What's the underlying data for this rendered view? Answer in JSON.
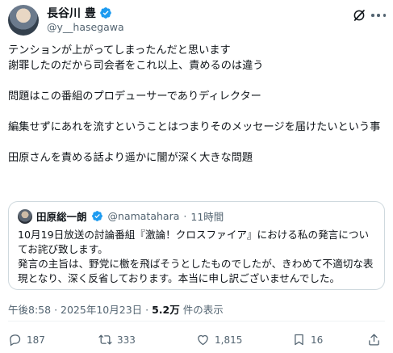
{
  "author": {
    "name": "長谷川 豊",
    "handle": "@y__hasegawa"
  },
  "post": {
    "lines": [
      "テンションが上がってしまったんだと思います",
      "謝罪したのだから司会者をこれ以上、責めるのは違う",
      "",
      "問題はこの番組のプロデューサーでありディレクター",
      "",
      "編集せずにあれを流すということはつまりそのメッセージを届けたいという事",
      "",
      "田原さんを責める話より遥かに闇が深く大きな問題"
    ]
  },
  "quote": {
    "name": "田原総一朗",
    "handle": "@namatahara",
    "separator": "·",
    "time": "11時間",
    "text": "10月19日放送の討論番組『激論！クロスファイア』における私の発言についてお詫び致します。\n発言の主旨は、野党に檄を飛ばそうとしたものでしたが、きわめて不適切な表現となり、深く反省しております。本当に申し訳ございませんでした。"
  },
  "meta": {
    "time": "午後8:58",
    "date": "2025年10月23日",
    "dot": "·",
    "views": "5.2万",
    "views_suffix": " 件の表示"
  },
  "actions": {
    "replies": "187",
    "reposts": "333",
    "likes": "1,815",
    "bookmarks": "16"
  },
  "icons": {
    "verified": "verified-badge-icon",
    "grok": "grok-icon",
    "more": "more-icon",
    "reply": "reply-icon",
    "repost": "repost-icon",
    "like": "heart-icon",
    "bookmark": "bookmark-icon",
    "share": "share-icon"
  },
  "colors": {
    "verified": "#1d9bf0",
    "text": "#0f1419",
    "muted": "#536471"
  }
}
